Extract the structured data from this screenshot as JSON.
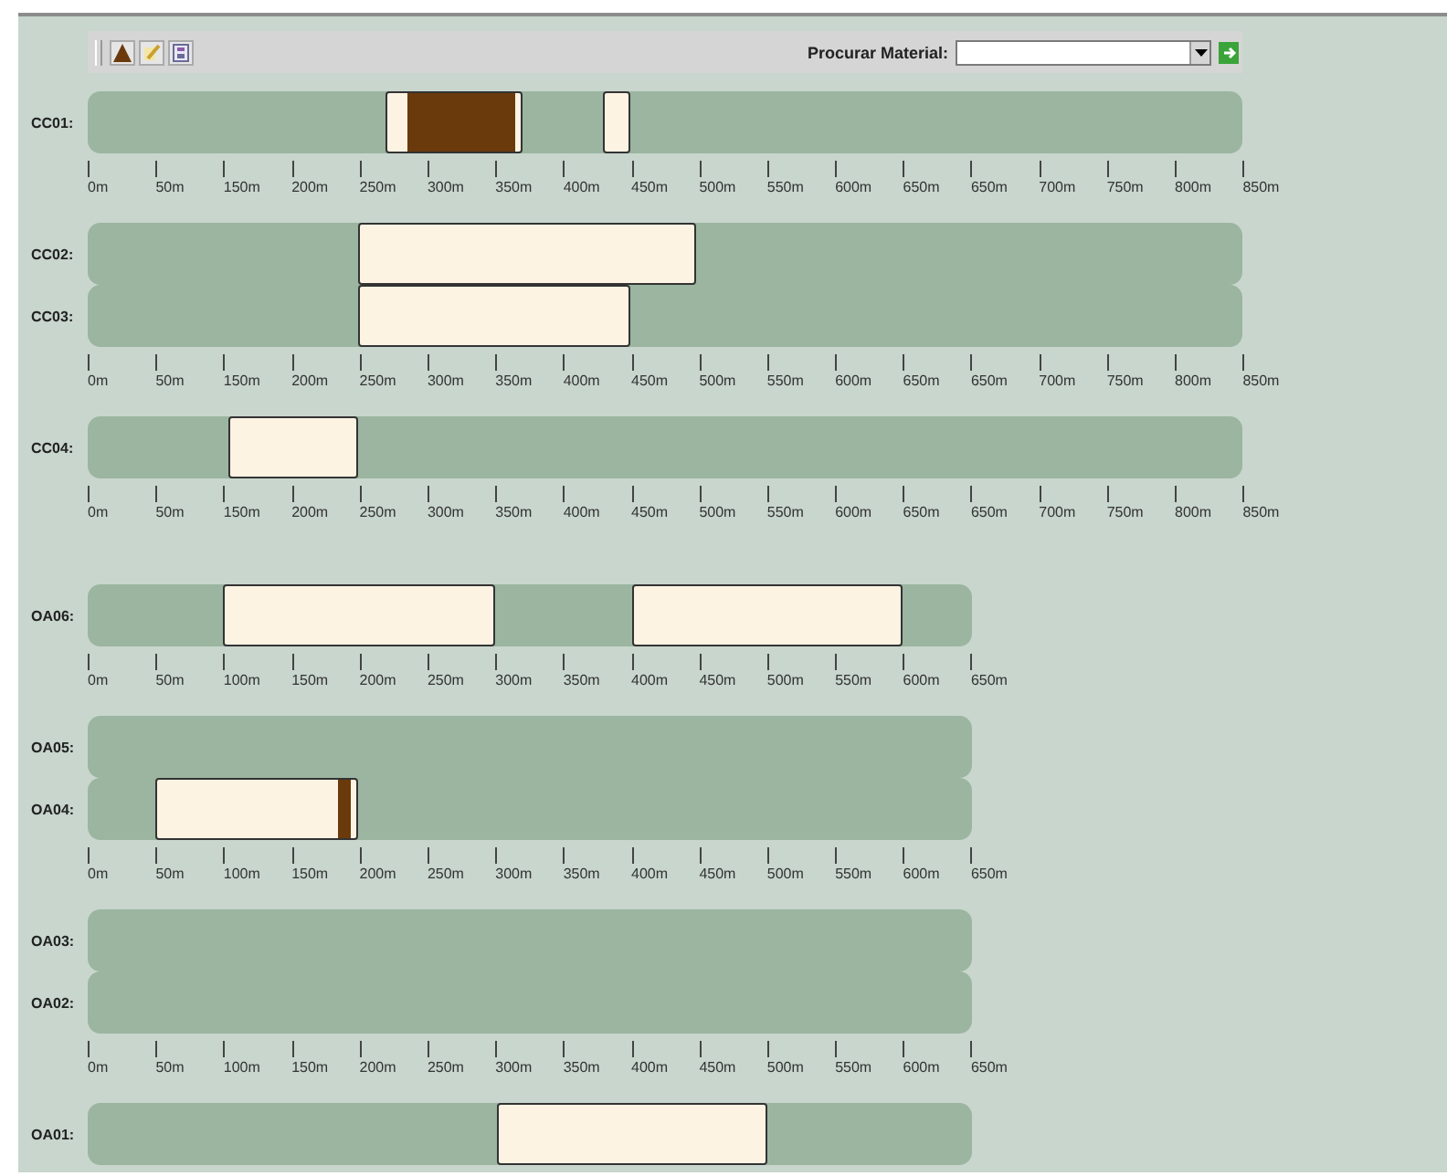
{
  "toolbar": {
    "search_label": "Procurar Material:"
  },
  "sections": [
    {
      "groups": [
        {
          "lanes": [
            {
              "label": "CC01:",
              "blocks": [
                {
                  "kind": "loaded"
                },
                {
                  "kind": "plain"
                }
              ]
            }
          ],
          "axis": [
            "0m",
            "50m",
            "150m",
            "200m",
            "250m",
            "300m",
            "350m",
            "400m",
            "450m",
            "500m",
            "550m",
            "600m",
            "650m",
            "650m",
            "700m",
            "750m",
            "800m",
            "850m"
          ]
        },
        {
          "lanes": [
            {
              "label": "CC02:",
              "blocks": [
                {
                  "kind": "plain"
                }
              ]
            },
            {
              "label": "CC03:",
              "blocks": [
                {
                  "kind": "plain"
                }
              ]
            }
          ],
          "axis": [
            "0m",
            "50m",
            "150m",
            "200m",
            "250m",
            "300m",
            "350m",
            "400m",
            "450m",
            "500m",
            "550m",
            "600m",
            "650m",
            "650m",
            "700m",
            "750m",
            "800m",
            "850m"
          ]
        },
        {
          "lanes": [
            {
              "label": "CC04:",
              "blocks": [
                {
                  "kind": "plain"
                }
              ]
            }
          ],
          "axis": [
            "0m",
            "50m",
            "150m",
            "200m",
            "250m",
            "300m",
            "350m",
            "400m",
            "450m",
            "500m",
            "550m",
            "600m",
            "650m",
            "650m",
            "700m",
            "750m",
            "800m",
            "850m"
          ]
        }
      ]
    },
    {
      "groups": [
        {
          "lanes": [
            {
              "label": "OA06:",
              "blocks": [
                {
                  "kind": "plain"
                },
                {
                  "kind": "plain"
                }
              ]
            }
          ],
          "axis": [
            "0m",
            "50m",
            "100m",
            "150m",
            "200m",
            "250m",
            "300m",
            "350m",
            "400m",
            "450m",
            "500m",
            "550m",
            "600m",
            "650m"
          ]
        },
        {
          "lanes": [
            {
              "label": "OA05:"
            },
            {
              "label": "OA04:",
              "blocks": [
                {
                  "kind": "loaded"
                }
              ]
            }
          ],
          "axis": [
            "0m",
            "50m",
            "100m",
            "150m",
            "200m",
            "250m",
            "300m",
            "350m",
            "400m",
            "450m",
            "500m",
            "550m",
            "600m",
            "650m"
          ]
        },
        {
          "lanes": [
            {
              "label": "OA03:"
            },
            {
              "label": "OA02:"
            }
          ],
          "axis": [
            "0m",
            "50m",
            "100m",
            "150m",
            "200m",
            "250m",
            "300m",
            "350m",
            "400m",
            "450m",
            "500m",
            "550m",
            "600m",
            "650m"
          ]
        },
        {
          "lanes": [
            {
              "label": "OA01:",
              "blocks": [
                {
                  "kind": "plain"
                }
              ]
            }
          ]
        }
      ]
    }
  ]
}
